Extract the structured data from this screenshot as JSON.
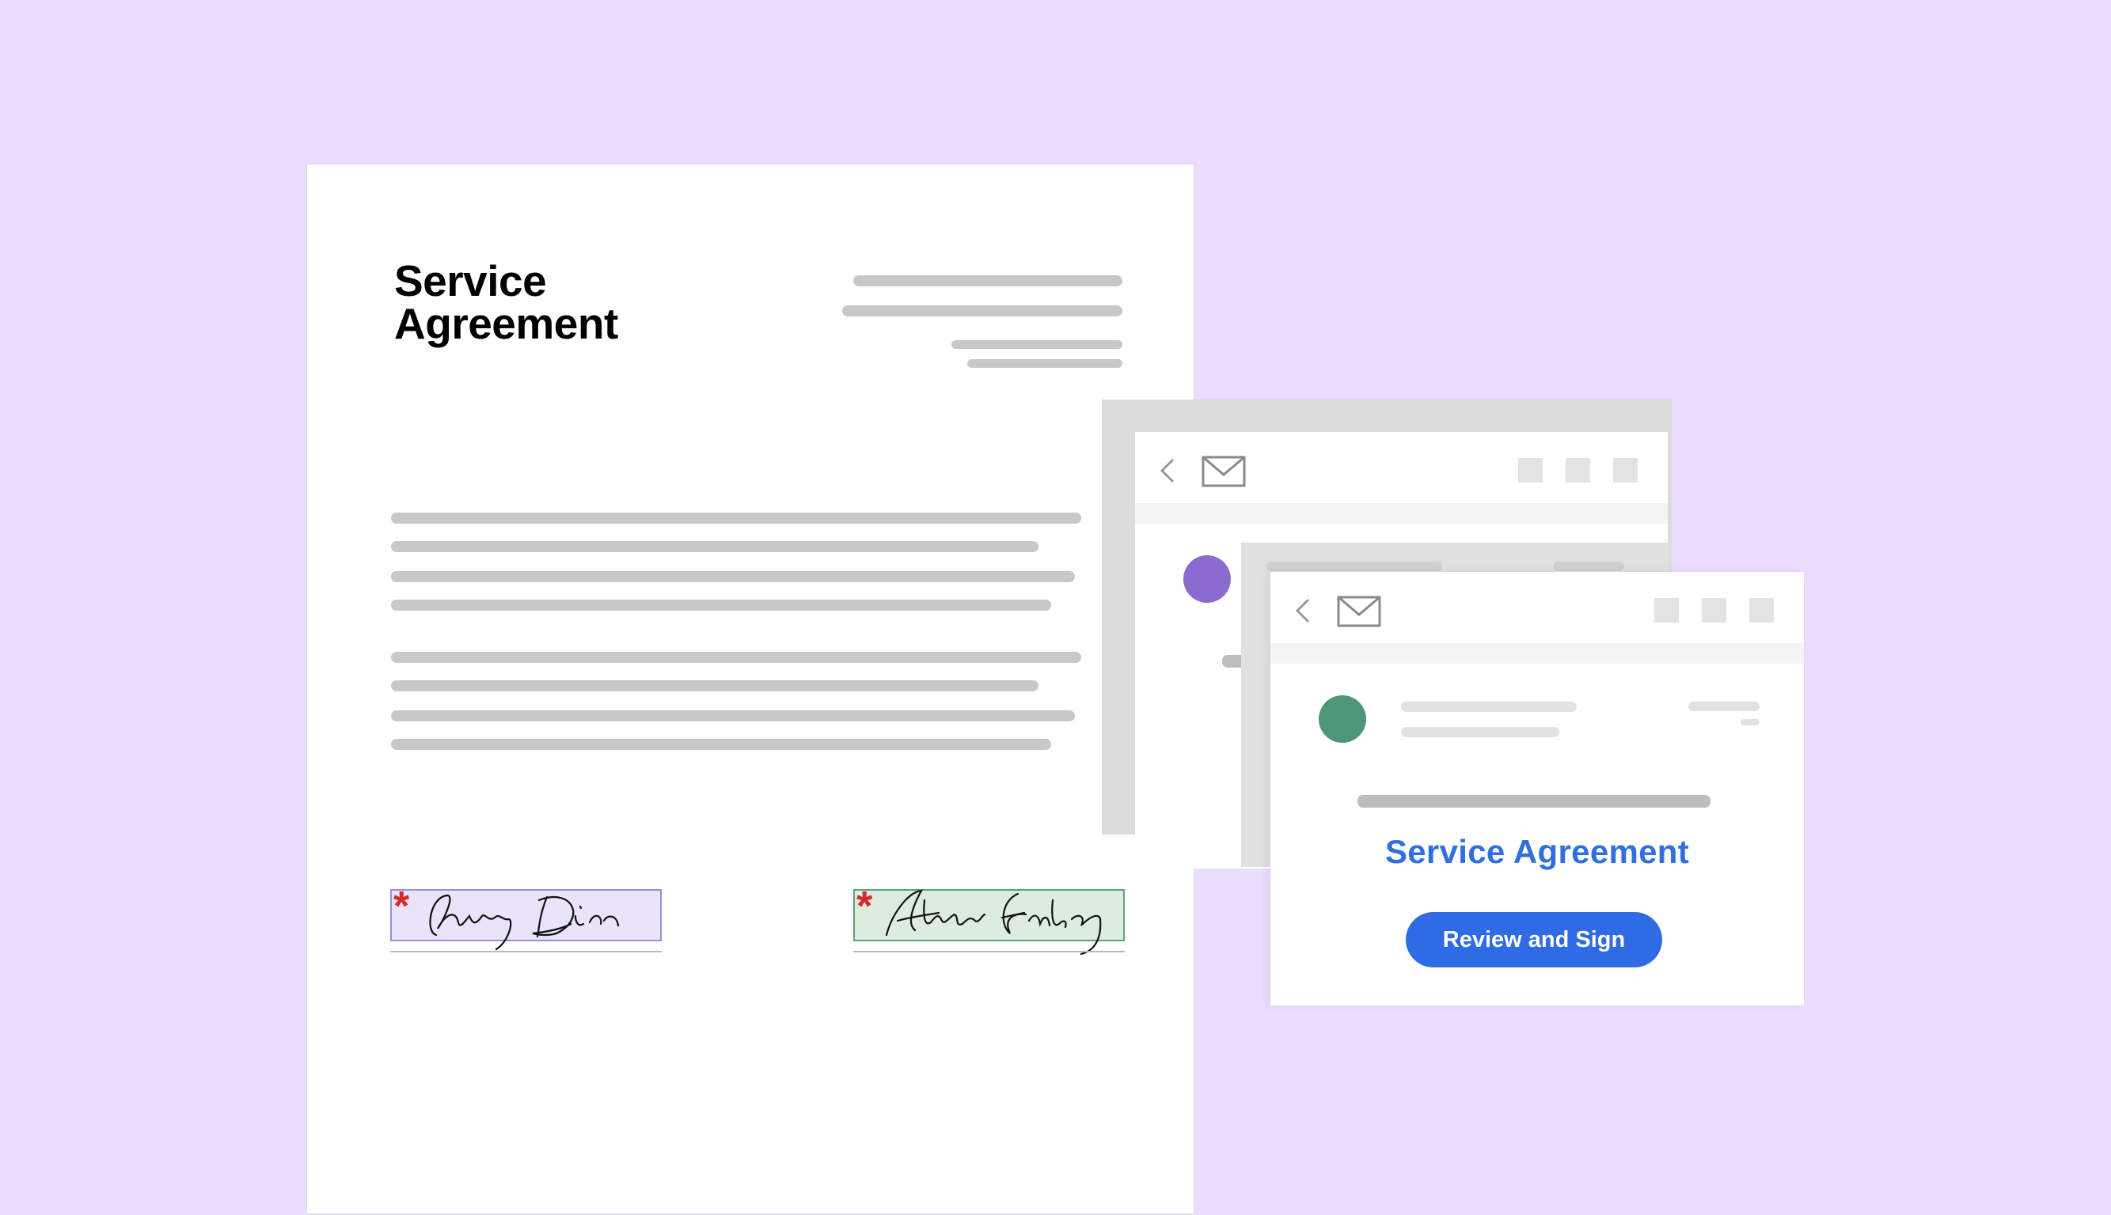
{
  "document": {
    "title_line1": "Service",
    "title_line2": "Agreement",
    "signature_required_mark": "*"
  },
  "email": {
    "heading": "Service Agreement",
    "review_button_label": "Review and Sign"
  },
  "colors": {
    "background": "#ecdcfd",
    "signature_box_1_fill": "#e9e3fb",
    "signature_box_1_border": "#9b8cd8",
    "signature_box_2_fill": "#dcede0",
    "signature_box_2_border": "#5aa27a",
    "required_mark": "#d7282a",
    "avatar_purple": "#8b6bd0",
    "avatar_green": "#4e9677",
    "accent_blue": "#2f6be4"
  },
  "icons": [
    "chevron-left-icon",
    "mail-icon"
  ]
}
